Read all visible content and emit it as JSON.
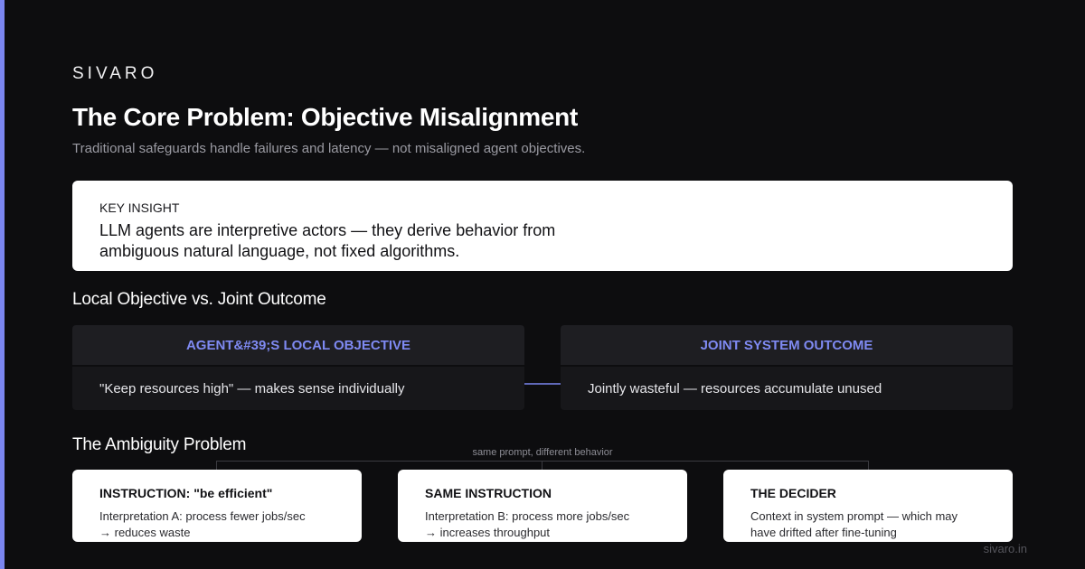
{
  "brand": "SIVARO",
  "title": "The Core Problem: Objective Misalignment",
  "subtitle": "Traditional safeguards handle failures and latency — not misaligned agent objectives.",
  "insight": {
    "label": "KEY INSIGHT",
    "text": "LLM agents are interpretive actors — they derive behavior from ambiguous natural language, not fixed algorithms."
  },
  "comparison": {
    "heading": "Local Objective vs. Joint Outcome",
    "left": {
      "header": "AGENT&#39;S LOCAL OBJECTIVE",
      "body": "\"Keep resources high\" — makes sense individually"
    },
    "right": {
      "header": "JOINT SYSTEM OUTCOME",
      "body": "Jointly wasteful — resources accumulate unused"
    }
  },
  "ambiguity": {
    "heading": "The Ambiguity Problem",
    "connector_label": "same prompt, different behavior",
    "cards": [
      {
        "title": "INSTRUCTION: \"be efficient\"",
        "line1": "Interpretation A: process fewer jobs/sec",
        "line2": "→ reduces waste"
      },
      {
        "title": "SAME INSTRUCTION",
        "line1": "Interpretation B: process more jobs/sec",
        "line2": "→ increases throughput"
      },
      {
        "title": "THE DECIDER",
        "line1": "Context in system prompt — which may",
        "line2": "have drifted after fine-tuning"
      }
    ]
  },
  "footer": "sivaro.in",
  "colors": {
    "background": "#0d0d0f",
    "accent": "#7b86f0",
    "card": "#ffffff",
    "panel_header": "#1e1e22",
    "panel_body": "#17171a"
  }
}
